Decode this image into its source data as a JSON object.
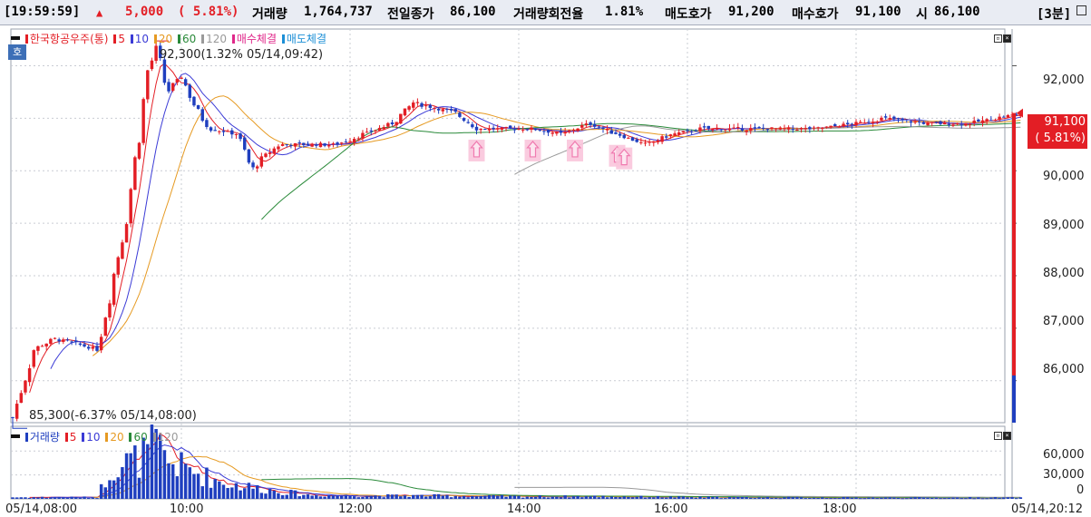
{
  "topbar": {
    "time": "[19:59:59]",
    "arrow": "▲",
    "change": "5,000",
    "change_pct": "( 5.81%)",
    "volume_label": "거래량",
    "volume": "1,764,737",
    "prev_label": "전일종가",
    "prev_close": "86,100",
    "turnover_label": "거래량회전율",
    "turnover": "1.81%",
    "ask_label": "매도호가",
    "ask": "91,200",
    "bid_label": "매수호가",
    "bid": "91,100",
    "open_label": "시",
    "open": "86,100",
    "interval": "[3분]"
  },
  "price_legend": {
    "name": "한국항공우주(통)",
    "ma5": "5",
    "ma10": "10",
    "ma20": "20",
    "ma60": "60",
    "ma120": "120",
    "buy": "매수체결",
    "sell": "매도체결"
  },
  "ho_icon": "호",
  "annotations": {
    "high": "92,300(1.32% 05/14,09:42)",
    "low": "85,300(-6.37% 05/14,08:00)"
  },
  "current_price": {
    "value": "91,100",
    "pct": "( 5.81%)"
  },
  "price_axis": [
    "92,000",
    "91,000",
    "90,000",
    "89,000",
    "88,000",
    "87,000",
    "86,000"
  ],
  "volume_legend": {
    "name": "거래량",
    "ma5": "5",
    "ma10": "10",
    "ma20": "20",
    "ma60": "60",
    "ma120": "120"
  },
  "volume_axis": [
    "60,000",
    "30,000",
    "0"
  ],
  "time_axis": [
    "05/14,08:00",
    "10:00",
    "12:00",
    "14:00",
    "16:00",
    "18:00",
    "05/14,20:12"
  ],
  "colors": {
    "up": "#e31e25",
    "down": "#1f3fbf",
    "ma5": "#e31e25",
    "ma10": "#3b3bd6",
    "ma20": "#e69a22",
    "ma60": "#2a8a3a",
    "ma120": "#9a9a9a",
    "buy_signal": "#f07bb0"
  },
  "chart_data": {
    "type": "candlestick",
    "interval_min": 3,
    "price_range": [
      85200,
      92700
    ],
    "volume_range": [
      0,
      75000
    ],
    "close_path": [
      [
        "08:00",
        85300
      ],
      [
        "08:15",
        86600
      ],
      [
        "08:30",
        86800
      ],
      [
        "08:45",
        86700
      ],
      [
        "09:00",
        86600
      ],
      [
        "09:10",
        87800
      ],
      [
        "09:20",
        89000
      ],
      [
        "09:30",
        90700
      ],
      [
        "09:36",
        91900
      ],
      [
        "09:42",
        92300
      ],
      [
        "09:50",
        91500
      ],
      [
        "10:00",
        91800
      ],
      [
        "10:10",
        91200
      ],
      [
        "10:20",
        90800
      ],
      [
        "10:40",
        90700
      ],
      [
        "10:50",
        90000
      ],
      [
        "11:00",
        90300
      ],
      [
        "11:10",
        90500
      ],
      [
        "11:30",
        90500
      ],
      [
        "11:50",
        90500
      ],
      [
        "12:10",
        90700
      ],
      [
        "12:30",
        90900
      ],
      [
        "12:45",
        91300
      ],
      [
        "13:00",
        91200
      ],
      [
        "13:15",
        91100
      ],
      [
        "13:30",
        90800
      ],
      [
        "13:50",
        90800
      ],
      [
        "14:10",
        90800
      ],
      [
        "14:30",
        90700
      ],
      [
        "14:50",
        90900
      ],
      [
        "15:10",
        90700
      ],
      [
        "15:30",
        90500
      ],
      [
        "15:50",
        90700
      ],
      [
        "16:10",
        90800
      ],
      [
        "16:30",
        90800
      ],
      [
        "17:00",
        90800
      ],
      [
        "17:30",
        90800
      ],
      [
        "18:00",
        90900
      ],
      [
        "18:20",
        91000
      ],
      [
        "18:50",
        90900
      ],
      [
        "19:20",
        90900
      ],
      [
        "19:59",
        91100
      ]
    ],
    "buy_signals": [
      "13:30",
      "14:10",
      "14:40",
      "15:10",
      "15:15"
    ],
    "volume_path": [
      [
        "08:00",
        2000
      ],
      [
        "09:00",
        2000
      ],
      [
        "09:10",
        40000
      ],
      [
        "09:30",
        50000
      ],
      [
        "09:42",
        68000
      ],
      [
        "09:50",
        48000
      ],
      [
        "10:00",
        40000
      ],
      [
        "10:30",
        20000
      ],
      [
        "11:00",
        12000
      ],
      [
        "11:30",
        5000
      ],
      [
        "12:00",
        4000
      ],
      [
        "13:00",
        4000
      ],
      [
        "14:00",
        3000
      ],
      [
        "15:00",
        3000
      ],
      [
        "16:00",
        2000
      ],
      [
        "18:00",
        1500
      ],
      [
        "20:00",
        1500
      ]
    ]
  }
}
